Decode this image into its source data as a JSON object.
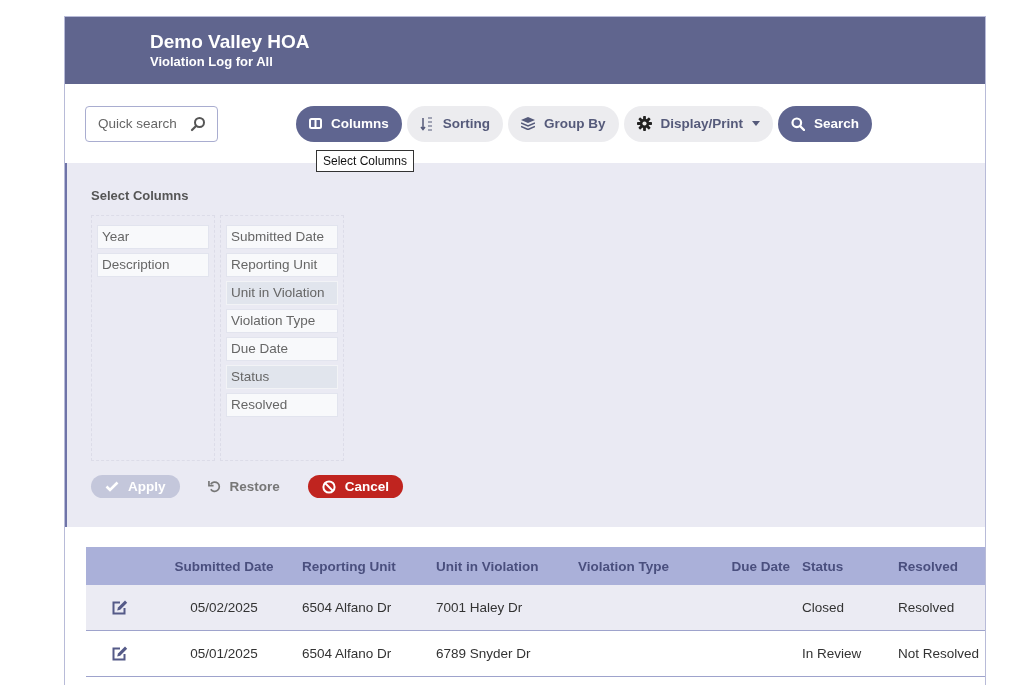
{
  "header": {
    "title": "Demo Valley HOA",
    "subtitle": "Violation Log for All"
  },
  "quick_search": {
    "placeholder": "Quick search"
  },
  "toolbar": [
    {
      "kind": "columns",
      "label": "Columns",
      "selected": true,
      "dropdown": false
    },
    {
      "kind": "sorting",
      "label": "Sorting",
      "selected": false,
      "dropdown": false
    },
    {
      "kind": "group",
      "label": "Group By",
      "selected": false,
      "dropdown": false
    },
    {
      "kind": "display",
      "label": "Display/Print",
      "selected": false,
      "dropdown": true
    },
    {
      "kind": "search",
      "label": "Search",
      "selected": true,
      "dropdown": false
    }
  ],
  "tooltip": "Select Columns",
  "column_panel": {
    "title": "Select Columns",
    "available": [
      {
        "label": "Year",
        "selected": false
      },
      {
        "label": "Description",
        "selected": false
      }
    ],
    "chosen": [
      {
        "label": "Submitted Date",
        "selected": false
      },
      {
        "label": "Reporting Unit",
        "selected": false
      },
      {
        "label": "Unit in Violation",
        "selected": true
      },
      {
        "label": "Violation Type",
        "selected": false
      },
      {
        "label": "Due Date",
        "selected": false
      },
      {
        "label": "Status",
        "selected": true
      },
      {
        "label": "Resolved",
        "selected": false
      }
    ],
    "actions": [
      {
        "kind": "apply",
        "label": "Apply",
        "disabled": true
      },
      {
        "kind": "restore",
        "label": "Restore",
        "disabled": false
      },
      {
        "kind": "cancel",
        "label": "Cancel",
        "disabled": false
      }
    ]
  },
  "table": {
    "columns": [
      "Submitted Date",
      "Reporting Unit",
      "Unit in Violation",
      "Violation Type",
      "Due Date",
      "Status",
      "Resolved"
    ],
    "rows": [
      [
        "05/02/2025",
        "6504 Alfano Dr",
        "7001 Haley Dr",
        "",
        "",
        "Closed",
        "Resolved"
      ],
      [
        "05/01/2025",
        "6504 Alfano Dr",
        "6789 Snyder Dr",
        "",
        "",
        "In Review",
        "Not Resolved"
      ]
    ]
  }
}
